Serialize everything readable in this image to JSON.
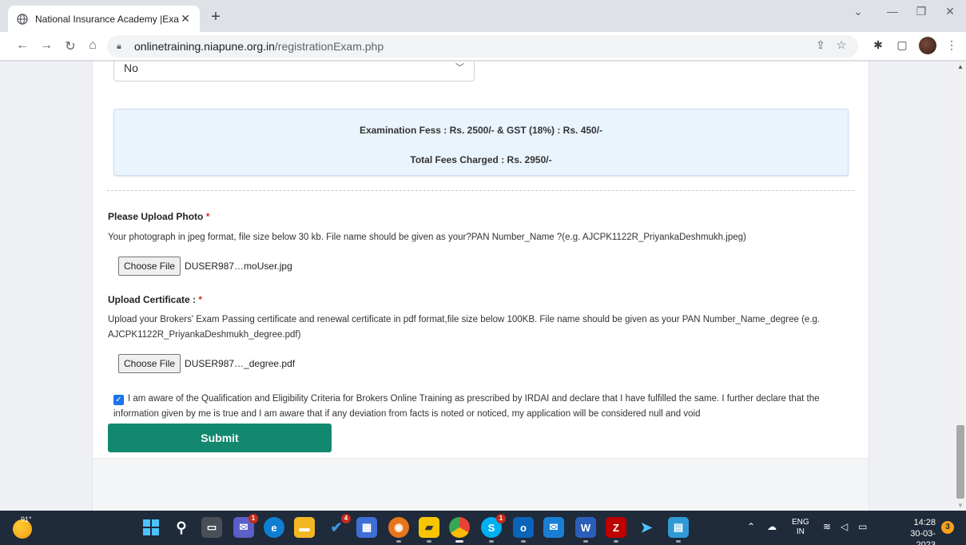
{
  "browser": {
    "tab_title": "National Insurance Academy |Exa",
    "new_tab": "+",
    "url_host": "onlinetraining.niapune.org.in",
    "url_path": "/registrationExam.php"
  },
  "form": {
    "select_value": "No",
    "fees_line1": "Examination Fess : Rs. 2500/- & GST (18%) : Rs. 450/-",
    "fees_line2": "Total Fees Charged : Rs. 2950/-",
    "photo_label": "Please Upload Photo",
    "photo_help": "Your photograph in jpeg format, file size below 30 kb. File name should be given as your?PAN Number_Name ?(e.g. AJCPK1122R_PriyankaDeshmukh.jpeg)",
    "photo_button": "Choose File",
    "photo_file": "DUSER987…moUser.jpg",
    "cert_label": "Upload Certificate :",
    "cert_help": "Upload your Brokers' Exam Passing certificate and renewal certificate in pdf format,file size below 100KB. File name should be given as your PAN Number_Name_degree (e.g. AJCPK1122R_PriyankaDeshmukh_degree.pdf)",
    "cert_button": "Choose File",
    "cert_file": "DUSER987…_degree.pdf",
    "required_mark": "*",
    "declaration": "I am aware of the Qualification and Eligibility Criteria for Brokers Online Training as prescribed by IRDAI and declare that I have fulfilled the same. I further declare that the information given by me is true and I am aware that if any deviation from facts is noted or noticed, my application will be considered null and void",
    "declaration_checked": true,
    "submit_label": "Submit"
  },
  "taskbar": {
    "temperature": "91°",
    "teams_badge": "1",
    "todo_badge": "4",
    "skype_badge": "1",
    "lang_line1": "ENG",
    "lang_line2": "IN",
    "time": "14:28",
    "date": "30-03-2023",
    "notifications": "3"
  },
  "colors": {
    "submit_bg": "#12886f",
    "fees_bg": "#eaf4fd",
    "required": "#e0262b",
    "taskbar_bg": "#1f2a3a"
  }
}
